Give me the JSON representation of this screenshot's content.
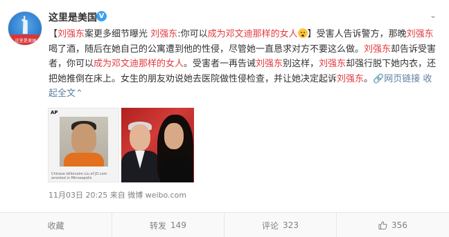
{
  "user": {
    "name": "这里是美国",
    "avatar_text": "这里是美国",
    "verified_glyph": "V"
  },
  "post": {
    "segments": [
      {
        "text": "【",
        "style": "normal"
      },
      {
        "text": "刘强东",
        "style": "red"
      },
      {
        "text": "案更多细节曝光 ",
        "style": "normal"
      },
      {
        "text": "刘强东",
        "style": "red"
      },
      {
        "text": ":你可以",
        "style": "normal"
      },
      {
        "text": "成为邓文迪那样的女人",
        "style": "red"
      },
      {
        "text": "EMOJI",
        "style": "emoji"
      },
      {
        "text": "】受害人告诉警方，那晚",
        "style": "normal"
      },
      {
        "text": "刘强东",
        "style": "red"
      },
      {
        "text": "喝了酒，随后在她自己的公寓遭到他的性侵，尽管她一直恳求对方不要这么做。",
        "style": "normal"
      },
      {
        "text": "刘强东",
        "style": "red"
      },
      {
        "text": "却告诉受害者，你可以",
        "style": "normal"
      },
      {
        "text": "成为邓文迪那样的女人",
        "style": "red"
      },
      {
        "text": "。受害者一再告诫",
        "style": "normal"
      },
      {
        "text": "刘强东",
        "style": "red"
      },
      {
        "text": "别这样，",
        "style": "normal"
      },
      {
        "text": "刘强东",
        "style": "red"
      },
      {
        "text": "却强行脱下她内衣，还把她推倒在床上。女生的朋友劝说她去医院做性侵检查，并让她决定起诉",
        "style": "normal"
      },
      {
        "text": "刘强东",
        "style": "red"
      },
      {
        "text": "。",
        "style": "normal"
      },
      {
        "text": "🔗网页链接",
        "style": "blue"
      },
      {
        "text": " 收起全文",
        "style": "blue"
      },
      {
        "text": "⌃",
        "style": "blue"
      }
    ],
    "photo1_logo": "AP",
    "photo1_caption": "Chinese billionaire Liu of JD.com arrested in Minneapolis"
  },
  "meta": {
    "date": "11月03日 20:25",
    "source_prefix": "来自",
    "source": "微博 weibo.com"
  },
  "actions": {
    "favorite_label": "收藏",
    "repost_label": "转发",
    "repost_count": "149",
    "comment_label": "评论",
    "comment_count": "323",
    "like_count": "356"
  },
  "colors": {
    "highlight": "#e4393c",
    "link": "#5d7ea4",
    "verified": "#3aa1f0"
  }
}
